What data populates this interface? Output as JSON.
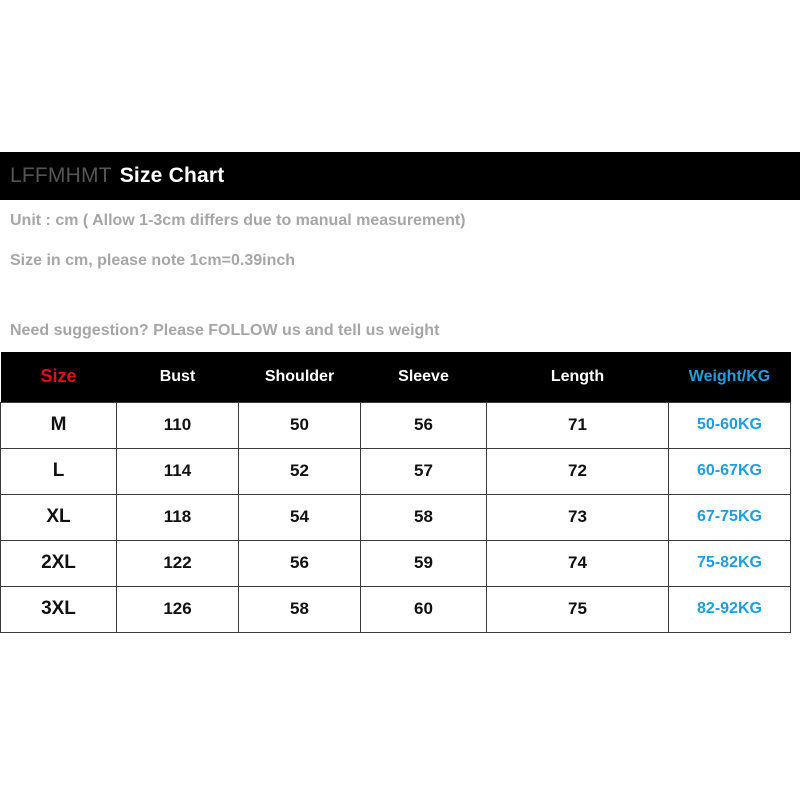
{
  "header": {
    "brand": "LFFMHMT",
    "title": "Size Chart"
  },
  "notes": [
    "Unit : cm ( Allow 1-3cm differs due to manual measurement)",
    "Size in cm, please note 1cm=0.39inch",
    "Need suggestion? Please FOLLOW us and tell us weight"
  ],
  "colors": {
    "banner_background": "#000000",
    "brand_text": "#555555",
    "title_text": "#ffffff",
    "note_text": "#a6a6a6",
    "header_background": "#000000",
    "size_header": "#e01010",
    "weight_accent": "#1e9ee0",
    "row_background": "#ffffff",
    "row_border": "#3a3a3a",
    "cell_text": "#111111"
  },
  "chart_data": {
    "type": "table",
    "title": "Size Chart",
    "columns": [
      "Size",
      "Bust",
      "Shoulder",
      "Sleeve",
      "Length",
      "Weight/KG"
    ],
    "rows": [
      [
        "M",
        "110",
        "50",
        "56",
        "71",
        "50-60KG"
      ],
      [
        "L",
        "114",
        "52",
        "57",
        "72",
        "60-67KG"
      ],
      [
        "XL",
        "118",
        "54",
        "58",
        "73",
        "67-75KG"
      ],
      [
        "2XL",
        "122",
        "56",
        "59",
        "74",
        "75-82KG"
      ],
      [
        "3XL",
        "126",
        "58",
        "60",
        "75",
        "82-92KG"
      ]
    ],
    "unit": "cm",
    "notes": [
      "Unit : cm ( Allow 1-3cm differs due to manual measurement)",
      "Size in cm, please note 1cm=0.39inch",
      "Need suggestion? Please FOLLOW us and tell us weight"
    ]
  }
}
